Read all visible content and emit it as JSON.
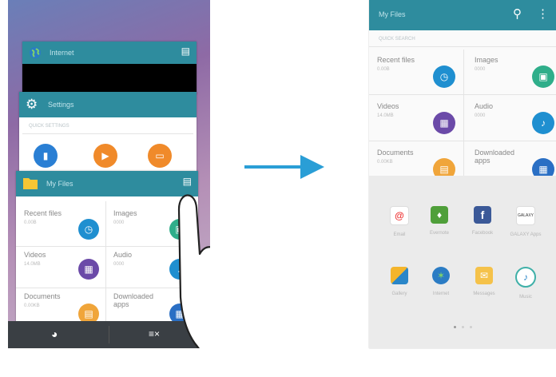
{
  "left_screen": {
    "internet_card": {
      "title": "Internet"
    },
    "settings_card": {
      "title": "Settings",
      "section": "QUICK SETTINGS"
    },
    "myfiles_card": {
      "title": "My Files",
      "items": [
        {
          "label": "Recent files",
          "sub": "0.00B"
        },
        {
          "label": "Images",
          "sub": "0000"
        },
        {
          "label": "Videos",
          "sub": "14.0MB"
        },
        {
          "label": "Audio",
          "sub": "0000"
        },
        {
          "label": "Documents",
          "sub": "0.00KB"
        },
        {
          "label": "Downloaded apps",
          "sub": ""
        }
      ]
    }
  },
  "right_screen": {
    "title": "My Files",
    "section": "QUICK SEARCH",
    "items": [
      {
        "label": "Recent files",
        "sub": "0.00B"
      },
      {
        "label": "Images",
        "sub": "0000"
      },
      {
        "label": "Videos",
        "sub": "14.0MB"
      },
      {
        "label": "Audio",
        "sub": "0000"
      },
      {
        "label": "Documents",
        "sub": "0.00KB"
      },
      {
        "label": "Downloaded apps",
        "sub": ""
      }
    ],
    "apps": [
      {
        "name": "Email",
        "icon": "email-icon"
      },
      {
        "name": "Evernote",
        "icon": "evernote-icon"
      },
      {
        "name": "Facebook",
        "icon": "facebook-icon"
      },
      {
        "name": "GALAXY Apps",
        "icon": "galaxy-apps-icon"
      },
      {
        "name": "Gallery",
        "icon": "gallery-icon"
      },
      {
        "name": "Internet",
        "icon": "globe-icon"
      },
      {
        "name": "Messages",
        "icon": "envelope-icon"
      },
      {
        "name": "Music",
        "icon": "music-note-icon"
      }
    ],
    "galaxy_badge": "GALAXY"
  },
  "colors": {
    "teal_header": "#2e8c9e",
    "arrow": "#2a9ed6",
    "clock_blue": "#1f8fd0",
    "image_green": "#2fae8a",
    "video_purple": "#6b4aa8",
    "audio_blue": "#1f8fd0",
    "docs_orange": "#f0a53a"
  }
}
